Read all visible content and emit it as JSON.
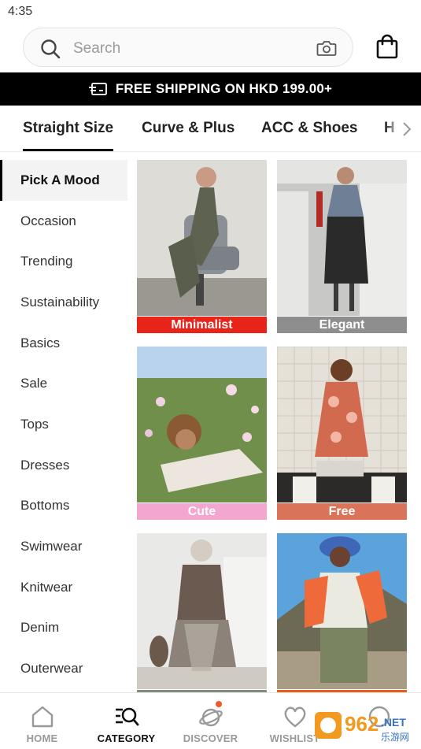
{
  "status_bar": {
    "time": "4:35"
  },
  "search": {
    "placeholder": "Search"
  },
  "promo": {
    "text": "FREE SHIPPING ON HKD 199.00+"
  },
  "tabs": [
    {
      "label": "Straight Size",
      "active": true
    },
    {
      "label": "Curve & Plus",
      "active": false
    },
    {
      "label": "ACC & Shoes",
      "active": false
    },
    {
      "label": "H",
      "active": false
    }
  ],
  "sidebar": {
    "items": [
      {
        "label": "Pick A Mood",
        "active": true
      },
      {
        "label": "Occasion"
      },
      {
        "label": "Trending"
      },
      {
        "label": "Sustainability"
      },
      {
        "label": "Basics"
      },
      {
        "label": "Sale"
      },
      {
        "label": "Tops"
      },
      {
        "label": "Dresses"
      },
      {
        "label": "Bottoms"
      },
      {
        "label": "Swimwear"
      },
      {
        "label": "Knitwear"
      },
      {
        "label": "Denim"
      },
      {
        "label": "Outerwear"
      }
    ]
  },
  "moods": [
    {
      "label": "Minimalist",
      "label_color": "#e8231a"
    },
    {
      "label": "Elegant",
      "label_color": "#8e8e8e"
    },
    {
      "label": "Cute",
      "label_color": "#f3a6cf"
    },
    {
      "label": "Free",
      "label_color": "#d9745a"
    },
    {
      "label": "",
      "label_color": "#7f8f7a"
    },
    {
      "label": "",
      "label_color": "#e85b1e"
    }
  ],
  "bottom_nav": [
    {
      "label": "HOME",
      "icon": "home-icon"
    },
    {
      "label": "CATEGORY",
      "icon": "category-search-icon",
      "active": true
    },
    {
      "label": "DISCOVER",
      "icon": "planet-icon",
      "badge": true
    },
    {
      "label": "WISHLIST",
      "icon": "heart-icon"
    },
    {
      "label": "",
      "icon": "profile-icon"
    }
  ],
  "watermark": {
    "number": "962",
    "suffix": ".NET",
    "sub": "乐游网"
  },
  "colors": {
    "accent": "#000000",
    "promo_bg": "#000000",
    "badge": "#f05a28"
  }
}
